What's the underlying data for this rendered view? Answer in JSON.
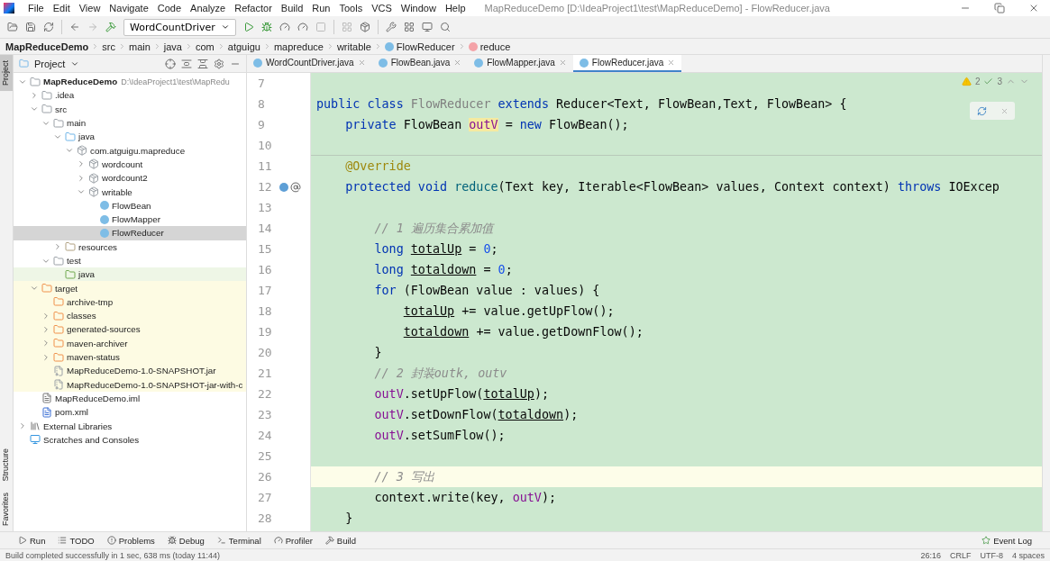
{
  "window": {
    "title": "MapReduceDemo [D:\\IdeaProject1\\test\\MapReduceDemo] - FlowReducer.java"
  },
  "menu": [
    "File",
    "Edit",
    "View",
    "Navigate",
    "Code",
    "Analyze",
    "Refactor",
    "Build",
    "Run",
    "Tools",
    "VCS",
    "Window",
    "Help"
  ],
  "toolbar": {
    "run_config": "WordCountDriver"
  },
  "breadcrumbs": [
    {
      "kind": "project",
      "text": "MapReduceDemo"
    },
    {
      "kind": "folder",
      "text": "src"
    },
    {
      "kind": "folder",
      "text": "main"
    },
    {
      "kind": "folder",
      "text": "java"
    },
    {
      "kind": "folder",
      "text": "com"
    },
    {
      "kind": "folder",
      "text": "atguigu"
    },
    {
      "kind": "folder",
      "text": "mapreduce"
    },
    {
      "kind": "folder",
      "text": "writable"
    },
    {
      "kind": "class",
      "text": "FlowReducer"
    },
    {
      "kind": "method",
      "text": "reduce"
    }
  ],
  "side_tabs": [
    {
      "label": "Project",
      "selected": true
    },
    {
      "label": "Structure",
      "selected": false
    },
    {
      "label": "Favorites",
      "selected": false
    }
  ],
  "project_panel": {
    "title": "Project",
    "tree": [
      {
        "kind": "module",
        "label": "MapReduceDemo",
        "hint": "D:\\IdeaProject1\\test\\MapRedu",
        "expanded": true,
        "children": [
          {
            "kind": "folder",
            "label": ".idea",
            "expanded": false
          },
          {
            "kind": "folder",
            "label": "src",
            "expanded": true,
            "children": [
              {
                "kind": "folder",
                "label": "main",
                "expanded": true,
                "children": [
                  {
                    "kind": "source",
                    "label": "java",
                    "expanded": true,
                    "children": [
                      {
                        "kind": "package",
                        "label": "com.atguigu.mapreduce",
                        "expanded": true,
                        "children": [
                          {
                            "kind": "package",
                            "label": "wordcount",
                            "expanded": false
                          },
                          {
                            "kind": "package",
                            "label": "wordcount2",
                            "expanded": false
                          },
                          {
                            "kind": "package",
                            "label": "writable",
                            "expanded": true,
                            "children": [
                              {
                                "kind": "class",
                                "label": "FlowBean",
                                "selected": false
                              },
                              {
                                "kind": "class",
                                "label": "FlowMapper",
                                "selected": false
                              },
                              {
                                "kind": "class",
                                "label": "FlowReducer",
                                "selected": true
                              }
                            ]
                          }
                        ]
                      }
                    ]
                  },
                  {
                    "kind": "resources",
                    "label": "resources",
                    "expanded": false
                  }
                ]
              },
              {
                "kind": "folder",
                "label": "test",
                "expanded": true,
                "children": [
                  {
                    "kind": "test",
                    "label": "java"
                  }
                ]
              }
            ]
          },
          {
            "kind": "excluded",
            "label": "target",
            "expanded": true,
            "children": [
              {
                "kind": "excluded",
                "label": "archive-tmp"
              },
              {
                "kind": "excluded",
                "label": "classes",
                "expanded": false
              },
              {
                "kind": "excluded",
                "label": "generated-sources",
                "expanded": false
              },
              {
                "kind": "excluded",
                "label": "maven-archiver",
                "expanded": false
              },
              {
                "kind": "excluded",
                "label": "maven-status",
                "expanded": false
              },
              {
                "kind": "excluded-jar",
                "label": "MapReduceDemo-1.0-SNAPSHOT.jar"
              },
              {
                "kind": "excluded-jar",
                "label": "MapReduceDemo-1.0-SNAPSHOT-jar-with-c"
              }
            ]
          },
          {
            "kind": "iml",
            "label": "MapReduceDemo.iml"
          },
          {
            "kind": "maven",
            "label": "pom.xml"
          }
        ]
      },
      {
        "kind": "libraries",
        "label": "External Libraries",
        "expanded": false
      },
      {
        "kind": "scratches",
        "label": "Scratches and Consoles"
      }
    ]
  },
  "editor_tabs": [
    {
      "label": "WordCountDriver.java",
      "selected": false
    },
    {
      "label": "FlowBean.java",
      "selected": false
    },
    {
      "label": "FlowMapper.java",
      "selected": false
    },
    {
      "label": "FlowReducer.java",
      "selected": true
    }
  ],
  "inspections": {
    "warnings": "2",
    "weak_warnings": "3"
  },
  "code": [
    {
      "number": "7"
    },
    {
      "number": "8",
      "tokens": [
        {
          "kind": "kw",
          "text": "public class"
        },
        {
          "kind": "grey",
          "text": " FlowReducer"
        },
        {
          "kind": "kw",
          "text": " extends"
        },
        {
          "kind": "plain",
          "text": " Reducer<Text, FlowBean,Text, FlowBean> {"
        }
      ]
    },
    {
      "number": "9",
      "tokens": [
        {
          "kind": "kw",
          "text": "    private"
        },
        {
          "kind": "plain",
          "text": " FlowBean"
        },
        {
          "kind": "field-hl",
          "text": " outV"
        },
        {
          "kind": "plain",
          "text": " ="
        },
        {
          "kind": "kw",
          "text": " new"
        },
        {
          "kind": "plain",
          "text": " FlowBean();"
        }
      ]
    },
    {
      "number": "10",
      "separator": true
    },
    {
      "number": "11",
      "tokens": [
        {
          "kind": "anno",
          "text": "    @Override"
        }
      ]
    },
    {
      "number": "12",
      "overrides": true,
      "annotated": true,
      "tokens": [
        {
          "kind": "kw",
          "text": "    protected void"
        },
        {
          "kind": "method",
          "text": " reduce"
        },
        {
          "kind": "plain",
          "text": "(Text key, Iterable<FlowBean> values, Context context)"
        },
        {
          "kind": "kw",
          "text": " throws"
        },
        {
          "kind": "plain",
          "text": " IOExcep"
        }
      ]
    },
    {
      "number": "13"
    },
    {
      "number": "14",
      "tokens": [
        {
          "kind": "comment",
          "text": "        // 1 遍历集合累加值"
        }
      ]
    },
    {
      "number": "15",
      "tokens": [
        {
          "kind": "kw",
          "text": "        long"
        },
        {
          "kind": "var",
          "text": " totalUp"
        },
        {
          "kind": "plain",
          "text": " ="
        },
        {
          "kind": "num",
          "text": " 0"
        },
        {
          "kind": "plain",
          "text": ";"
        }
      ]
    },
    {
      "number": "16",
      "tokens": [
        {
          "kind": "kw",
          "text": "        long"
        },
        {
          "kind": "var",
          "text": " totaldown"
        },
        {
          "kind": "plain",
          "text": " ="
        },
        {
          "kind": "num",
          "text": " 0"
        },
        {
          "kind": "plain",
          "text": ";"
        }
      ]
    },
    {
      "number": "17",
      "tokens": [
        {
          "kind": "kw",
          "text": "        for"
        },
        {
          "kind": "plain",
          "text": " (FlowBean value : values) {"
        }
      ]
    },
    {
      "number": "18",
      "tokens": [
        {
          "kind": "var",
          "text": "            totalUp"
        },
        {
          "kind": "plain",
          "text": " += value.getUpFlow();"
        }
      ]
    },
    {
      "number": "19",
      "tokens": [
        {
          "kind": "var",
          "text": "            totaldown"
        },
        {
          "kind": "plain",
          "text": " += value.getDownFlow();"
        }
      ]
    },
    {
      "number": "20",
      "tokens": [
        {
          "kind": "plain",
          "text": "        }"
        }
      ]
    },
    {
      "number": "21",
      "tokens": [
        {
          "kind": "comment",
          "text": "        // 2 封装outk, outv"
        }
      ]
    },
    {
      "number": "22",
      "tokens": [
        {
          "kind": "field",
          "text": "        outV"
        },
        {
          "kind": "plain",
          "text": ".setUpFlow("
        },
        {
          "kind": "var",
          "text": "totalUp"
        },
        {
          "kind": "plain",
          "text": ");"
        }
      ]
    },
    {
      "number": "23",
      "tokens": [
        {
          "kind": "field",
          "text": "        outV"
        },
        {
          "kind": "plain",
          "text": ".setDownFlow("
        },
        {
          "kind": "var",
          "text": "totaldown"
        },
        {
          "kind": "plain",
          "text": ");"
        }
      ]
    },
    {
      "number": "24",
      "tokens": [
        {
          "kind": "field",
          "text": "        outV"
        },
        {
          "kind": "plain",
          "text": ".setSumFlow();"
        }
      ]
    },
    {
      "number": "25"
    },
    {
      "number": "26",
      "current": true,
      "tokens": [
        {
          "kind": "comment",
          "text": "        // 3 写出"
        }
      ]
    },
    {
      "number": "27",
      "tokens": [
        {
          "kind": "plain",
          "text": "        context.write(key,"
        },
        {
          "kind": "field",
          "text": " outV"
        },
        {
          "kind": "plain",
          "text": ");"
        }
      ]
    },
    {
      "number": "28",
      "tokens": [
        {
          "kind": "plain",
          "text": "    }"
        }
      ]
    }
  ],
  "bottom_tools": [
    {
      "kind": "run",
      "label": "Run"
    },
    {
      "kind": "todo",
      "label": "TODO"
    },
    {
      "kind": "problems",
      "label": "Problems"
    },
    {
      "kind": "debug",
      "label": "Debug"
    },
    {
      "kind": "terminal",
      "label": "Terminal"
    },
    {
      "kind": "profiler",
      "label": "Profiler"
    },
    {
      "kind": "build",
      "label": "Build"
    }
  ],
  "event_log": "Event Log",
  "status_bar": {
    "message": "Build completed successfully in 1 sec, 638 ms (today 11:44)",
    "position": "26:16",
    "line_separator": "CRLF",
    "encoding": "UTF-8",
    "indent": "4 spaces"
  }
}
